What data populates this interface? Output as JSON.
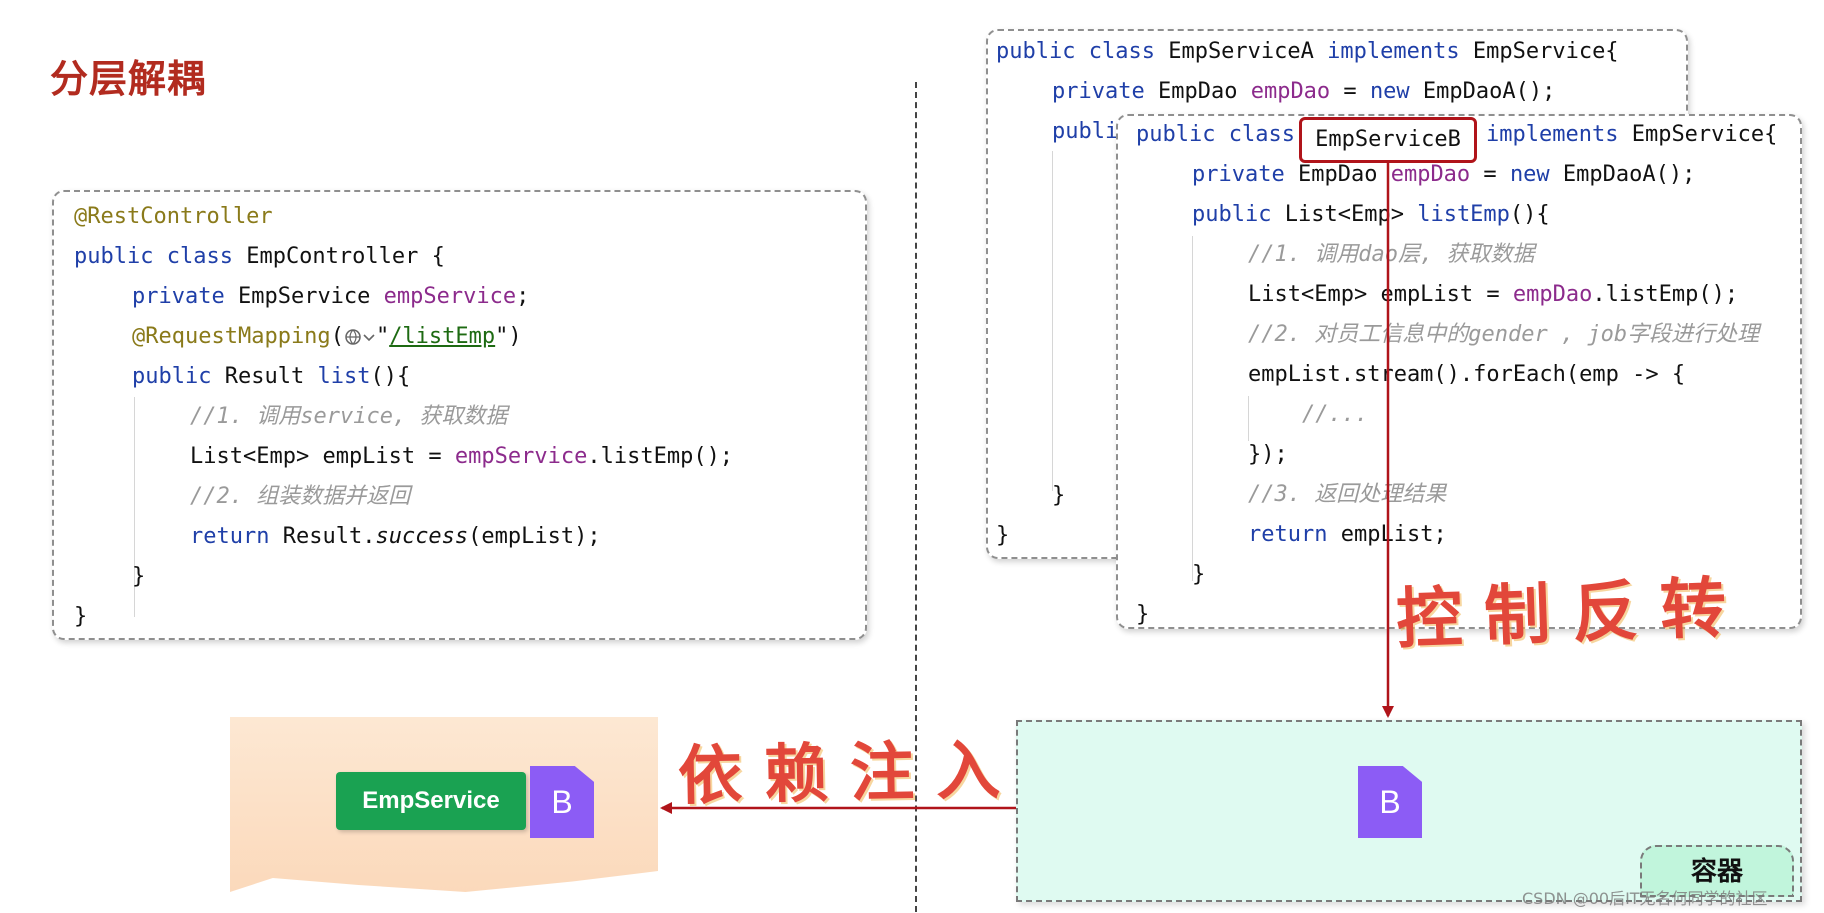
{
  "title": "分层解耦",
  "controller": {
    "annotation": "@RestController",
    "class_kw": "public class",
    "class_name": "EmpController {",
    "field_kw": "private",
    "field_type": "EmpService",
    "field_name": "empService",
    "field_end": ";",
    "mapping_ann": "@RequestMapping",
    "mapping_open": "(",
    "mapping_quote_open": "\"",
    "mapping_path": "/listEmp",
    "mapping_close": "\")",
    "method_kw": "public",
    "method_rest_a": "Result",
    "method_name": "list",
    "method_rest_b": "(){",
    "comment1": "//1. 调用service, 获取数据",
    "line_list_a": "List<Emp> empList = ",
    "line_list_field": "empService",
    "line_list_b": ".listEmp();",
    "comment2": "//2. 组装数据并返回",
    "return_kw": "return",
    "return_a": " Result.",
    "return_method": "success",
    "return_b": "(empList);",
    "close_method": "}",
    "close_class": "}"
  },
  "service_a": {
    "class_kw": "public class",
    "class_name": "EmpServiceA",
    "implements_kw": "implements",
    "interface": "EmpService{",
    "field_kw": "private",
    "field_type": "EmpDao",
    "field_name": "empDao",
    "field_eq": " = ",
    "new_kw": "new",
    "field_init": " EmpDaoA();",
    "method_kw": "publi",
    "close_method": "}",
    "close_class": "}"
  },
  "service_b": {
    "class_kw": "public class",
    "class_name": "EmpServiceB",
    "implements_kw": "implements",
    "interface": "EmpService{",
    "field_kw": "private",
    "field_type": "EmpDao",
    "field_name": "empDao",
    "field_eq": " = ",
    "new_kw": "new",
    "field_init": " EmpDaoA();",
    "method_kw": "public",
    "method_type": "List<Emp>",
    "method_name": "listEmp",
    "method_end": "(){",
    "comment1": "//1. 调用dao层, 获取数据",
    "line_list_a": "List<Emp> empList = ",
    "line_list_field": "empDao",
    "line_list_b": ".listEmp();",
    "comment2": "//2. 对员工信息中的gender , job字段进行处理",
    "foreach": "empList.stream().forEach(emp -> {",
    "comment_dots": "//...",
    "close_lambda": "});",
    "comment3": "//3. 返回处理结果",
    "return_kw": "return",
    "return_rest": " empList;",
    "close_method": "}",
    "close_class": "}"
  },
  "labels": {
    "ioc": "控制反转",
    "di": "依赖注入",
    "empservice": "EmpService",
    "bean_letter": "B",
    "container": "容器"
  },
  "colors": {
    "title": "#b22b1f",
    "arrow": "#b0141a",
    "bean": "#8c5cf5",
    "tag": "#1aa252",
    "container_bg": "#dffaf1",
    "consumer_bg": "#fde8d3"
  },
  "watermark": "CSDN @00后IT无名何同学的社区"
}
